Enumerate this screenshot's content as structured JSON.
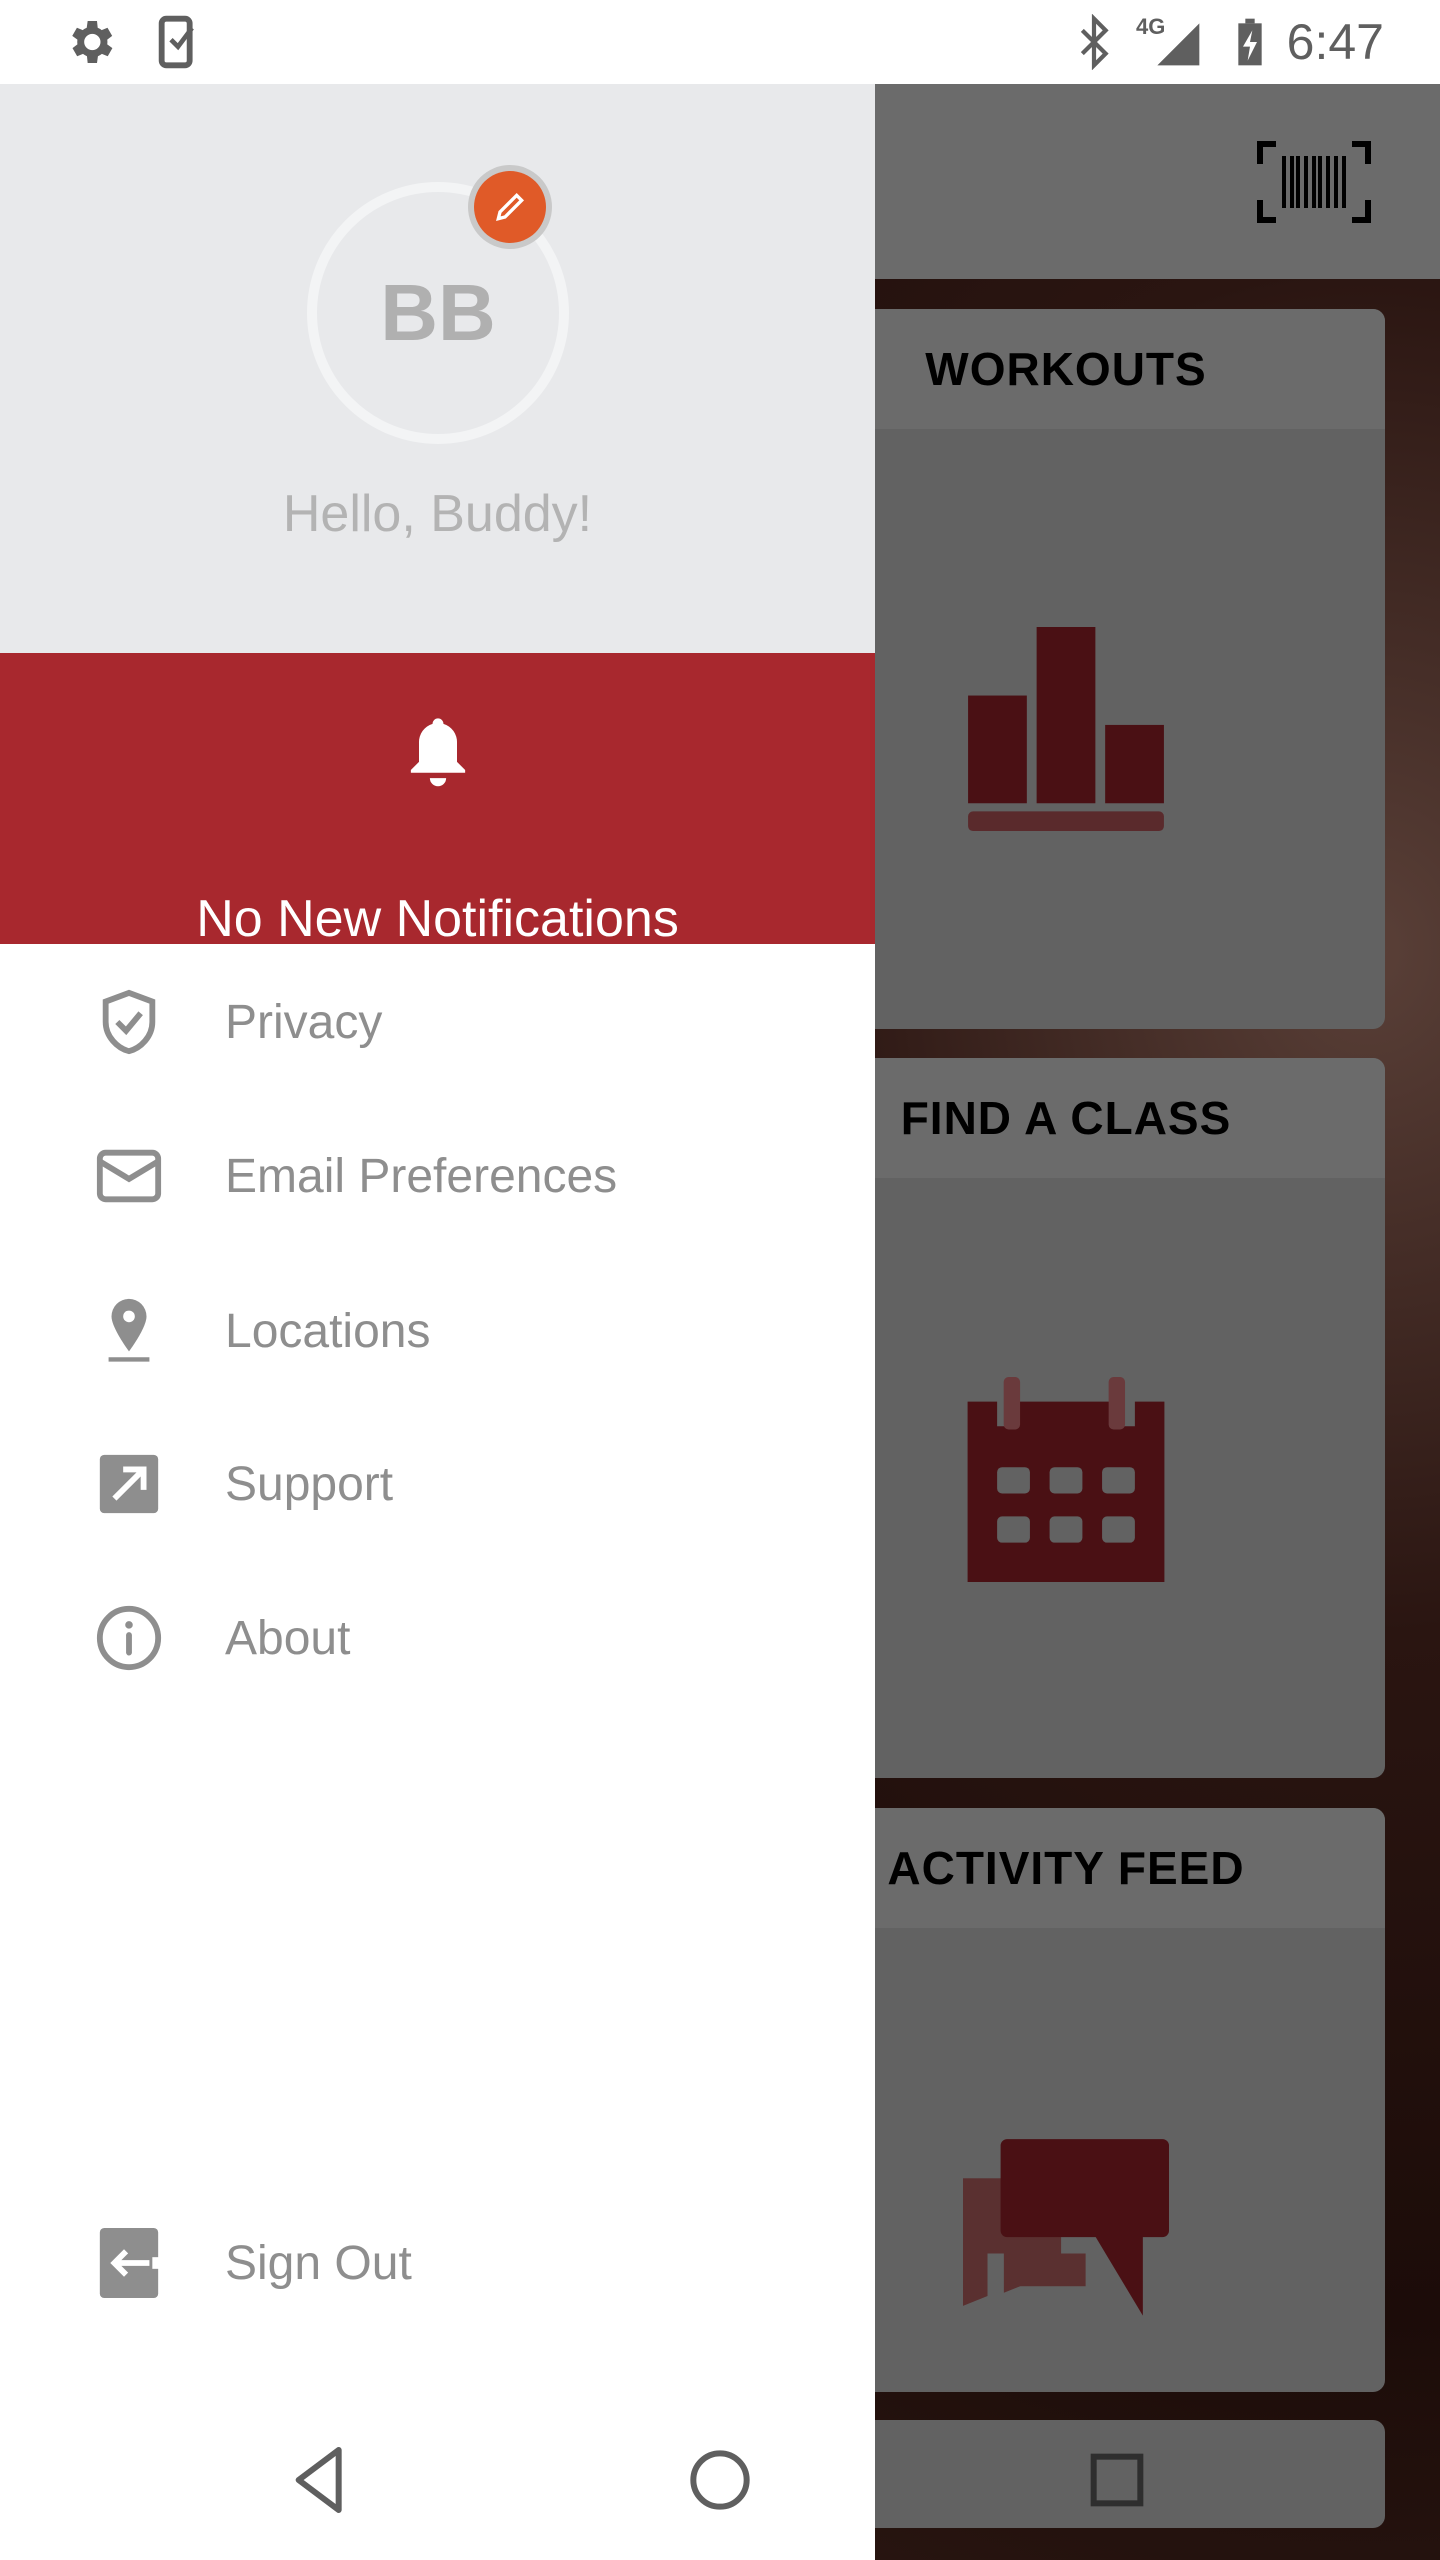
{
  "status_bar": {
    "time": "6:47",
    "network": "4G",
    "left_icons": [
      "gear-icon",
      "phone-check-icon"
    ],
    "right_icons": [
      "bluetooth-icon",
      "signal-icon",
      "battery-charging-icon"
    ]
  },
  "drawer": {
    "avatar_initials": "BB",
    "greeting": "Hello, Buddy!",
    "notifications": "No New Notifications",
    "menu": [
      {
        "label": "Privacy",
        "icon": "shield-check-icon"
      },
      {
        "label": "Email Preferences",
        "icon": "envelope-icon"
      },
      {
        "label": "Locations",
        "icon": "location-pin-icon"
      },
      {
        "label": "Support",
        "icon": "external-link-icon"
      },
      {
        "label": "About",
        "icon": "info-icon"
      }
    ],
    "sign_out": "Sign Out"
  },
  "main": {
    "cards": [
      {
        "title": "WORKOUTS",
        "icon": "bar-chart-icon"
      },
      {
        "title": "FIND A CLASS",
        "icon": "calendar-icon"
      },
      {
        "title": "ACTIVITY FEED",
        "icon": "chat-bubbles-icon"
      }
    ]
  },
  "colors": {
    "accent": "#a8282e",
    "edit": "#e05a28",
    "icon_maroon": "#4a1014",
    "menu_text": "#8e8e8e"
  }
}
